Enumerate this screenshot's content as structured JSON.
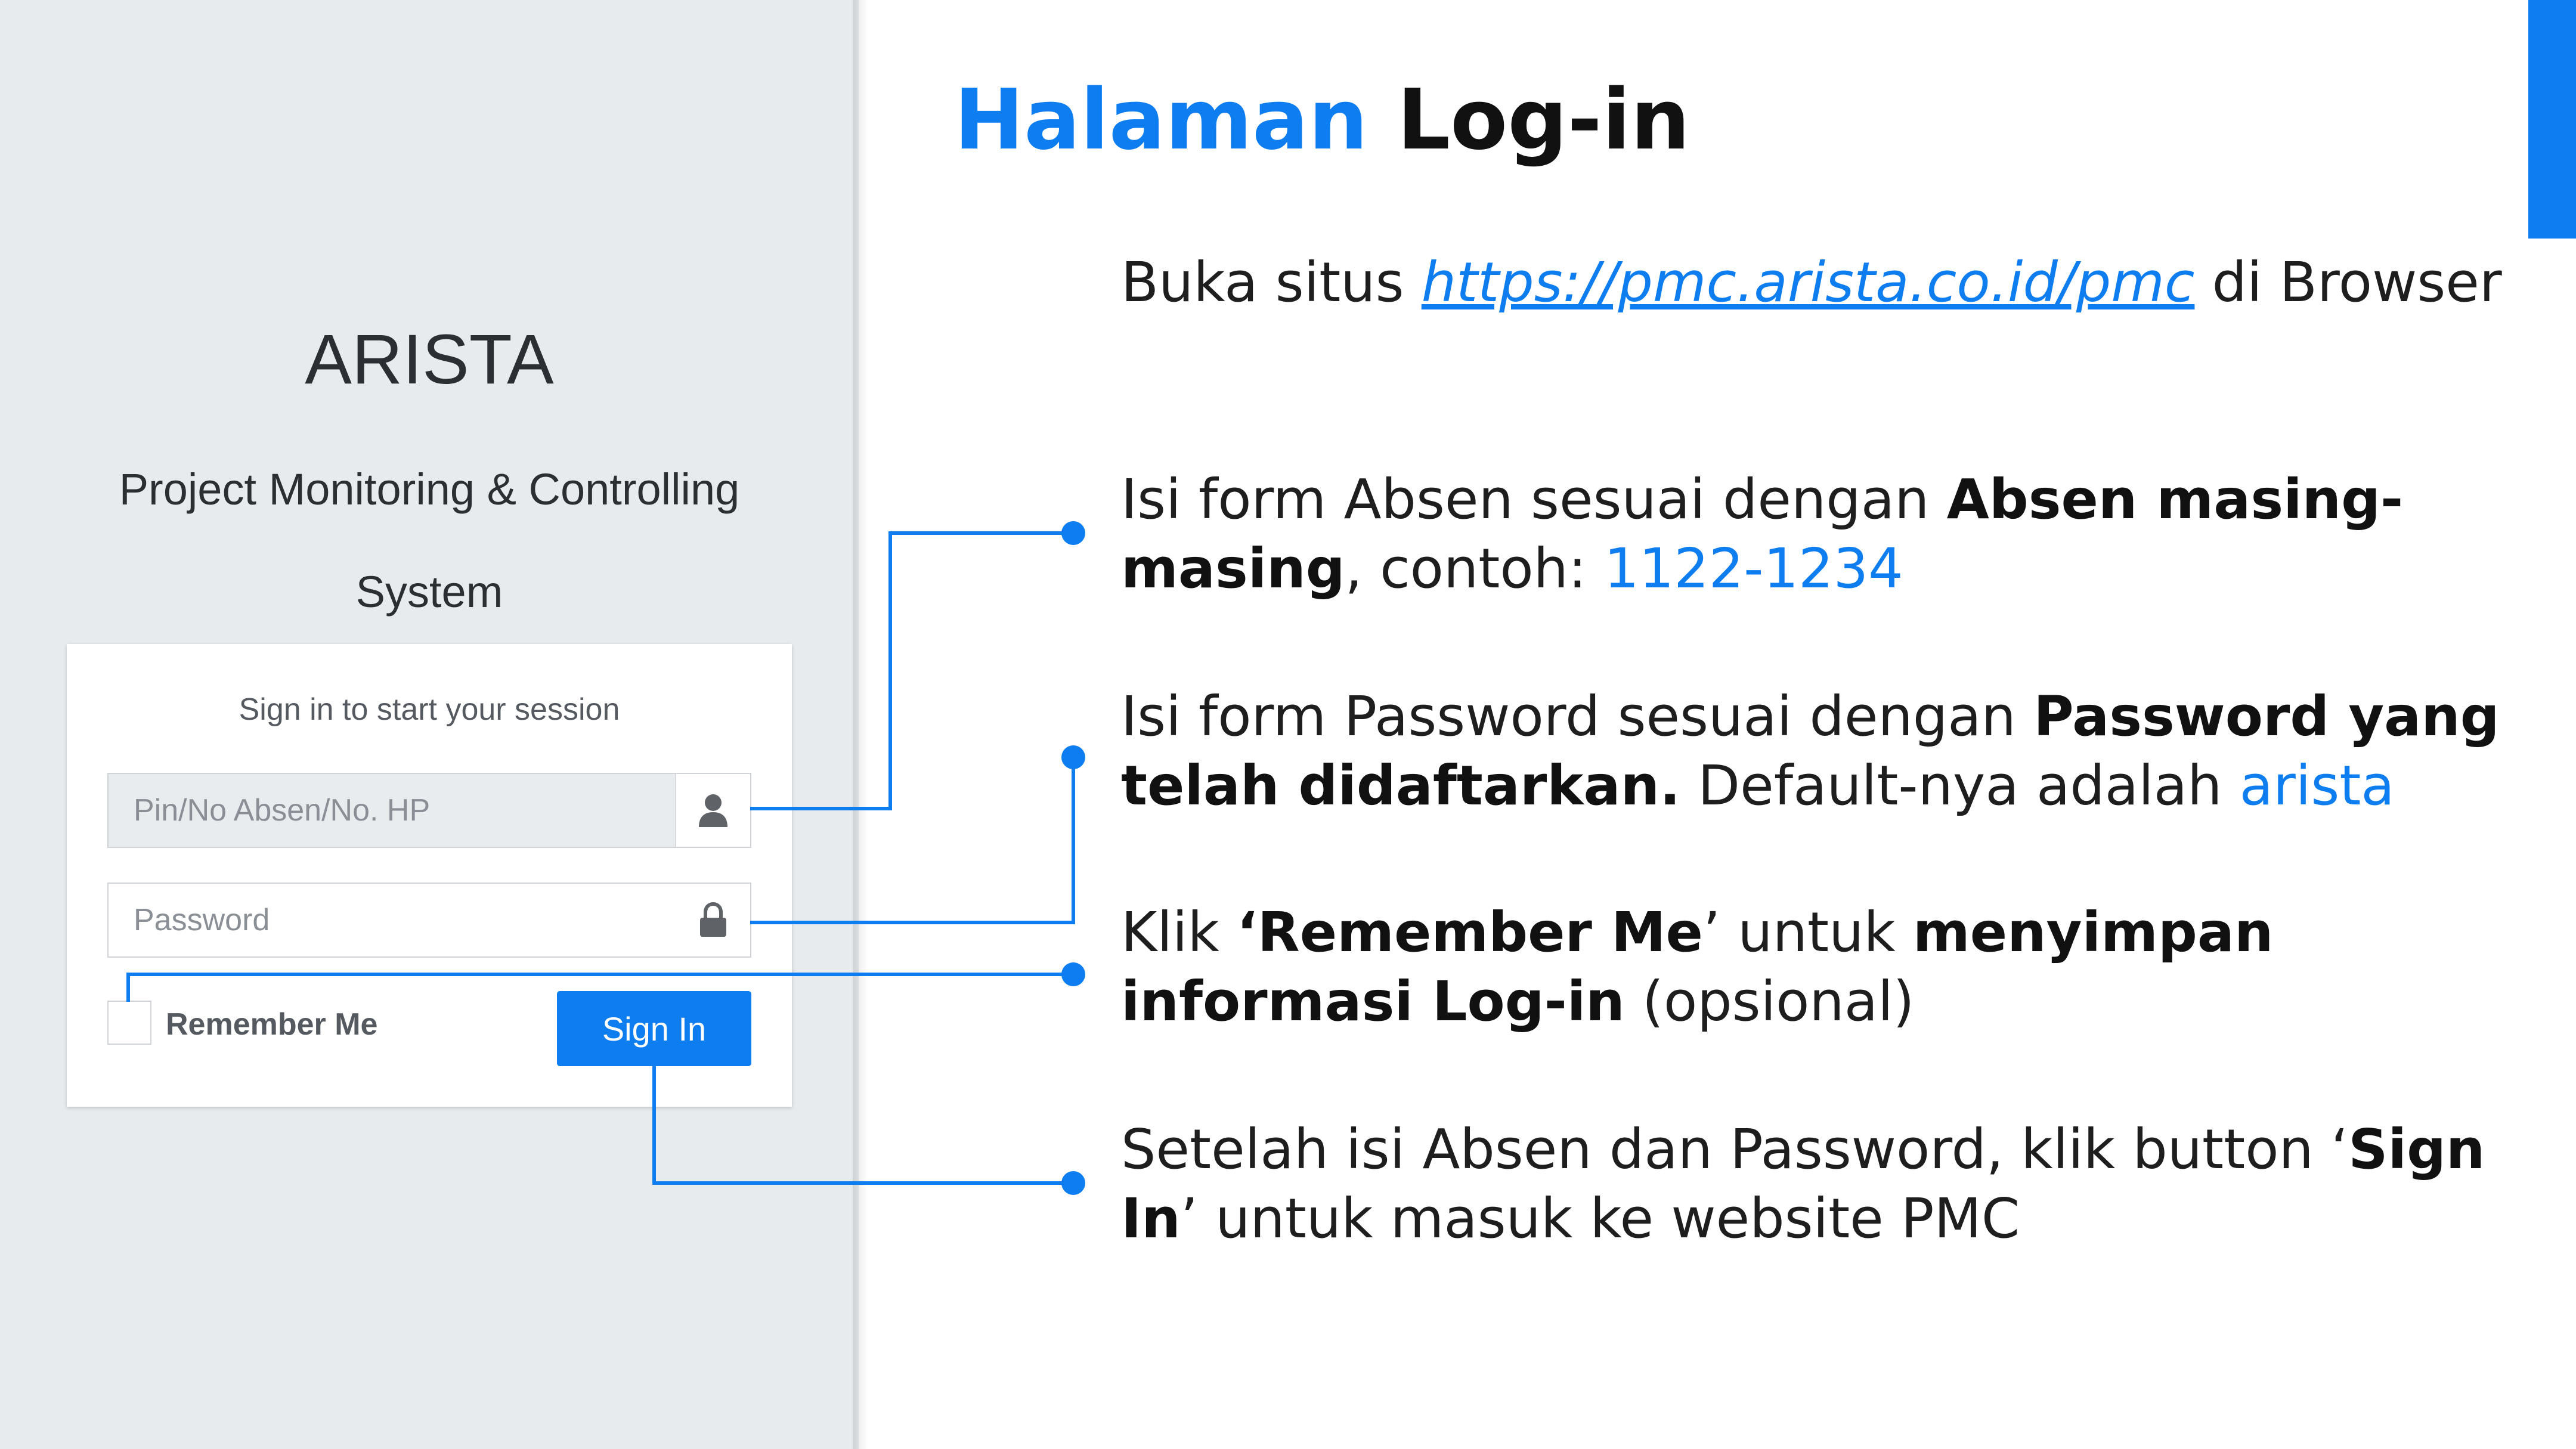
{
  "login_page": {
    "logo": "ARISTA",
    "title_line1": "Project Monitoring & Controlling",
    "title_line2": "System",
    "box_msg": "Sign in to start your session",
    "absen_placeholder": "Pin/No Absen/No. HP",
    "password_placeholder": "Password",
    "remember_label": "Remember Me",
    "signin_label": "Sign In",
    "user_icon": "user-icon",
    "lock_icon": "lock-icon"
  },
  "slide": {
    "title_part1": "Halaman",
    "title_part2": "Log-in",
    "accent_color": "#0d7df0",
    "instructions": {
      "step1": {
        "prefix": "Buka situs ",
        "link": "https://pmc.arista.co.id/pmc",
        "suffix": " di Browser"
      },
      "step2": {
        "prefix": "Isi form Absen sesuai dengan ",
        "bold": "Absen masing-masing",
        "middle": ", contoh: ",
        "example": "1122-1234"
      },
      "step3": {
        "prefix": "Isi form Password sesuai dengan ",
        "bold": "Password yang telah didaftarkan.",
        "middle": " Default-nya adalah ",
        "example": "arista"
      },
      "step4": {
        "prefix": "Klik ",
        "bold1": "‘Remember Me",
        "middle": "’ untuk ",
        "bold2": "menyimpan informasi Log-in",
        "suffix": " (opsional)"
      },
      "step5": {
        "prefix": "Setelah isi Absen dan Password, klik button ‘",
        "bold": "Sign In",
        "suffix": "’ untuk masuk ke website PMC"
      }
    }
  }
}
